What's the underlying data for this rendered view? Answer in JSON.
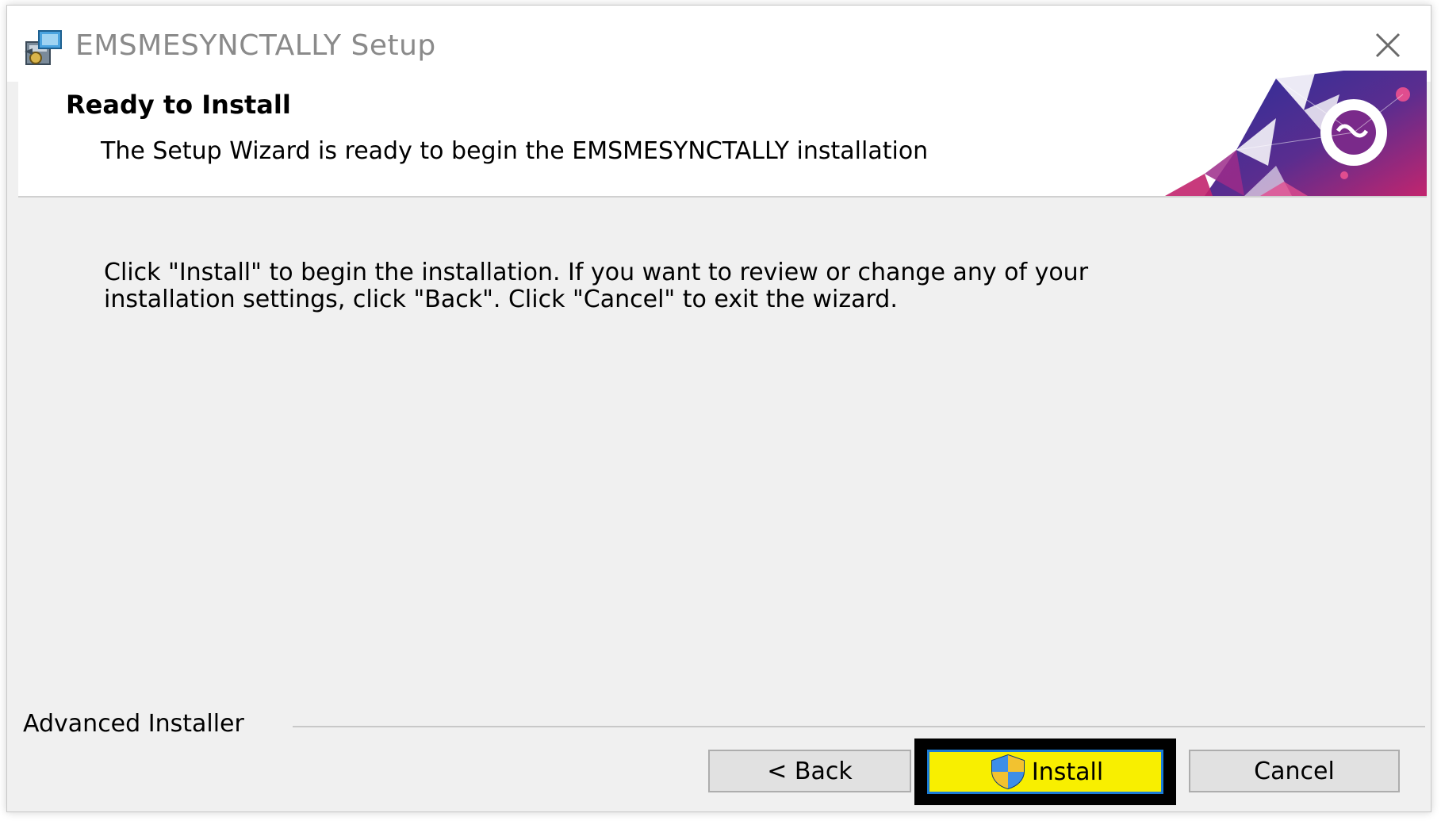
{
  "window": {
    "title": "EMSMESYNCTALLY Setup",
    "icon": "installer-package-icon"
  },
  "header": {
    "title": "Ready to Install",
    "subtitle": "The Setup Wizard is ready to begin the EMSMESYNCTALLY installation"
  },
  "body": {
    "instructions": "Click \"Install\" to begin the installation.  If you want to review or change any of your\ninstallation settings, click \"Back\".  Click \"Cancel\" to exit the wizard."
  },
  "footer": {
    "brand": "Advanced Installer",
    "buttons": {
      "back": "< Back",
      "install": "Install",
      "cancel": "Cancel"
    }
  },
  "colors": {
    "install_highlight": "#f8ef00",
    "install_border": "#1a7bd6",
    "banner_accent": "#b0246e",
    "banner_primary": "#3a2a8c"
  }
}
